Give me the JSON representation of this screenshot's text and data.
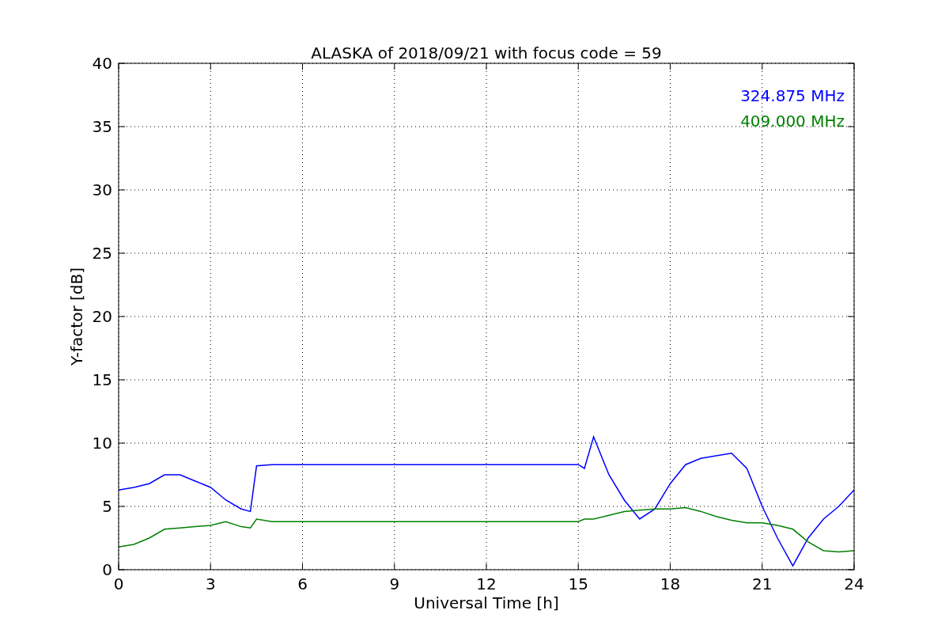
{
  "figure": {
    "chart_data": {
      "type": "line",
      "title": "ALASKA of 2018/09/21 with focus code = 59",
      "xlabel": "Universal Time [h]",
      "ylabel": "Y-factor [dB]",
      "x": [
        0,
        0.5,
        1,
        1.5,
        2,
        2.5,
        3,
        3.5,
        4,
        4.3,
        4.5,
        5,
        15,
        15.2,
        15.5,
        16,
        16.5,
        17,
        17.5,
        18,
        18.5,
        19,
        19.5,
        20,
        20.5,
        21,
        21.5,
        22,
        22.5,
        23,
        23.5,
        24
      ],
      "series": [
        {
          "name": "324.875 MHz",
          "color": "#0000ff",
          "values": [
            6.3,
            6.5,
            6.8,
            7.5,
            7.5,
            7.0,
            6.5,
            5.5,
            4.8,
            4.6,
            8.2,
            8.3,
            8.3,
            8.0,
            10.5,
            7.5,
            5.5,
            4.0,
            4.8,
            6.8,
            8.3,
            8.8,
            9.0,
            9.2,
            8.0,
            5.0,
            2.5,
            0.3,
            2.5,
            4.0,
            5.0,
            6.3
          ]
        },
        {
          "name": "409.000 MHz",
          "color": "#008000",
          "values": [
            1.8,
            2.0,
            2.5,
            3.2,
            3.3,
            3.4,
            3.5,
            3.8,
            3.4,
            3.3,
            4.0,
            3.8,
            3.8,
            4.0,
            4.0,
            4.3,
            4.6,
            4.7,
            4.8,
            4.8,
            4.9,
            4.6,
            4.2,
            3.9,
            3.7,
            3.7,
            3.5,
            3.2,
            2.2,
            1.5,
            1.4,
            1.5
          ]
        }
      ],
      "xlim": [
        0,
        24
      ],
      "ylim": [
        0,
        40
      ],
      "xticks": [
        0,
        3,
        6,
        9,
        12,
        15,
        18,
        21,
        24
      ],
      "yticks": [
        0,
        5,
        10,
        15,
        20,
        25,
        30,
        35,
        40
      ],
      "grid": true
    }
  }
}
